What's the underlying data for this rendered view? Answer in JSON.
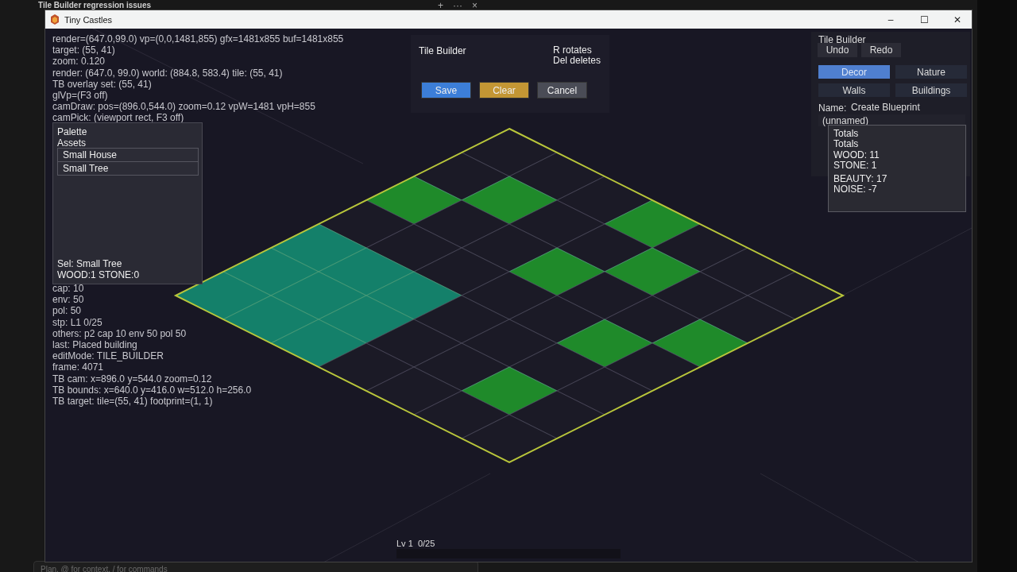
{
  "editor": {
    "title": "Tile Builder regression issues",
    "actions": [
      "+",
      "···",
      "×"
    ]
  },
  "chat_input": {
    "placeholder": "Plan, @ for context, / for commands"
  },
  "window": {
    "title": "Tiny Castles",
    "controls": [
      "–",
      "☐",
      "✕"
    ]
  },
  "debug_top": [
    "render=(647.0,99.0) vp=(0,0,1481,855) gfx=1481x855 buf=1481x855",
    "target: (55, 41)",
    "zoom: 0.120",
    "render: (647.0, 99.0) world: (884.8, 583.4) tile: (55, 41)",
    "TB overlay set: (55, 41)",
    "glVp=(F3 off)",
    "camDraw: pos=(896.0,544.0) zoom=0.12 vpW=1481 vpH=855",
    "camPick: (viewport rect, F3 off)"
  ],
  "debug_bottom": [
    "cap: 10",
    "env: 50",
    "pol: 50",
    "stp: L1 0/25",
    "others: p2 cap 10 env 50 pol 50",
    "last: Placed building",
    "editMode: TILE_BUILDER",
    "frame: 4071",
    "TB cam: x=896.0 y=544.0 zoom=0.12",
    "TB bounds: x=640.0 y=416.0 w=512.0 h=256.0",
    "TB target: tile=(55, 41) footprint=(1, 1)"
  ],
  "palette": {
    "title": "Palette",
    "subtitle": "Assets",
    "items": [
      "Small House",
      "Small Tree"
    ],
    "selection": "Sel: Small Tree",
    "cost": "WOOD:1 STONE:0"
  },
  "dialog": {
    "title": "Tile Builder",
    "hints": [
      "R rotates",
      "Del deletes"
    ],
    "buttons": [
      {
        "label": "Save",
        "kind": "primary"
      },
      {
        "label": "Clear",
        "kind": "warning"
      },
      {
        "label": "Cancel",
        "kind": "neutral"
      }
    ]
  },
  "side_panel": {
    "title": "Tile Builder",
    "history": [
      "Undo",
      "Redo"
    ],
    "categories": [
      {
        "label": "Decor",
        "selected": true
      },
      {
        "label": "Nature",
        "selected": false
      },
      {
        "label": "Walls",
        "selected": false
      },
      {
        "label": "Buildings",
        "selected": false
      }
    ],
    "action": "Create Blueprint",
    "name_label": "Name:",
    "name_value": "(unnamed)",
    "totals": [
      [
        "Totals",
        "Totals",
        "WOOD: 11",
        "STONE: 1"
      ],
      [
        "BEAUTY: 17",
        "NOISE: -7"
      ]
    ]
  },
  "grid": {
    "rows": [
      [
        {
          "kind": "empty"
        },
        {
          "kind": "empty"
        },
        {
          "kind": "grass"
        },
        {
          "kind": "empty"
        },
        {
          "kind": "water"
        },
        {
          "kind": "water"
        },
        {
          "kind": "water"
        }
      ],
      [
        {
          "kind": "empty"
        },
        {
          "kind": "grass"
        },
        {
          "kind": "empty"
        },
        {
          "kind": "empty"
        },
        {
          "kind": "water"
        },
        {
          "kind": "water"
        },
        {
          "kind": "water"
        }
      ],
      [
        {
          "kind": "empty"
        },
        {
          "kind": "empty"
        },
        {
          "kind": "empty"
        },
        {
          "kind": "empty"
        },
        {
          "kind": "water"
        },
        {
          "kind": "water"
        },
        {
          "kind": "water"
        }
      ],
      [
        {
          "kind": "grass"
        },
        {
          "kind": "empty"
        },
        {
          "kind": "grass"
        },
        {
          "kind": "empty"
        },
        {
          "kind": "empty"
        },
        {
          "kind": "empty"
        },
        {
          "kind": "empty"
        }
      ],
      [
        {
          "kind": "empty"
        },
        {
          "kind": "grass"
        },
        {
          "kind": "empty"
        },
        {
          "kind": "empty"
        },
        {
          "kind": "empty"
        },
        {
          "kind": "empty"
        },
        {
          "kind": "empty"
        }
      ],
      [
        {
          "kind": "empty"
        },
        {
          "kind": "empty"
        },
        {
          "kind": "empty"
        },
        {
          "kind": "grass"
        },
        {
          "kind": "empty"
        },
        {
          "kind": "grass"
        },
        {
          "kind": "empty"
        }
      ],
      [
        {
          "kind": "empty"
        },
        {
          "kind": "empty"
        },
        {
          "kind": "grass"
        },
        {
          "kind": "empty"
        },
        {
          "kind": "empty"
        },
        {
          "kind": "empty"
        },
        {
          "kind": "empty"
        }
      ]
    ]
  },
  "progress": {
    "label": "Lv 1  0/25",
    "level": 0
  }
}
